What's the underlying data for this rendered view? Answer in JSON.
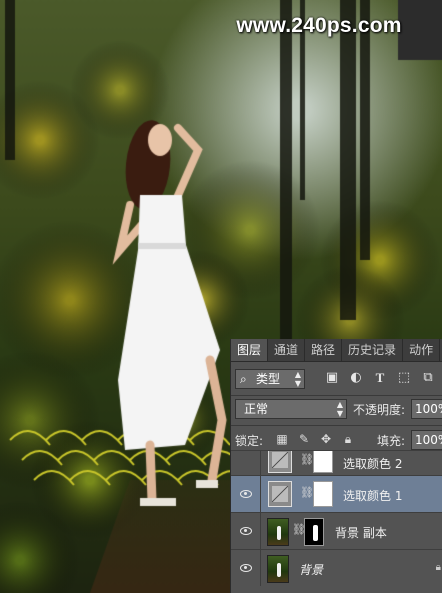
{
  "watermark": "www.240ps.com",
  "layers_panel": {
    "tabs": [
      {
        "label": "图层",
        "active": true
      },
      {
        "label": "通道",
        "active": false
      },
      {
        "label": "路径",
        "active": false
      },
      {
        "label": "历史记录",
        "active": false
      },
      {
        "label": "动作",
        "active": false
      }
    ],
    "filter": {
      "label": "类型",
      "icon": "search-icon"
    },
    "filter_icons": [
      "image-filter-icon",
      "adjustment-filter-icon",
      "text-filter-icon",
      "shape-filter-icon",
      "smart-object-filter-icon"
    ],
    "blend_mode": "正常",
    "opacity_label": "不透明度:",
    "opacity_value": "100%",
    "lock_label": "锁定:",
    "lock_icons": [
      "lock-transparent-icon",
      "lock-brush-icon",
      "lock-move-icon",
      "lock-all-icon"
    ],
    "fill_label": "填充:",
    "fill_value": "100%",
    "layers": [
      {
        "name": "选取颜色 2",
        "visible": false,
        "selected": false,
        "kind": "adjustment"
      },
      {
        "name": "选取颜色 1",
        "visible": true,
        "selected": true,
        "kind": "adjustment"
      },
      {
        "name": "背景 副本",
        "visible": true,
        "selected": false,
        "kind": "photo-masked"
      },
      {
        "name": "背景",
        "visible": true,
        "selected": false,
        "kind": "background",
        "locked": true
      }
    ]
  },
  "colors": {
    "panel_bg": "#535353",
    "selected_layer": "#6e7f96",
    "dress": "#f4f4f4",
    "foliage": "#b9b81e"
  }
}
